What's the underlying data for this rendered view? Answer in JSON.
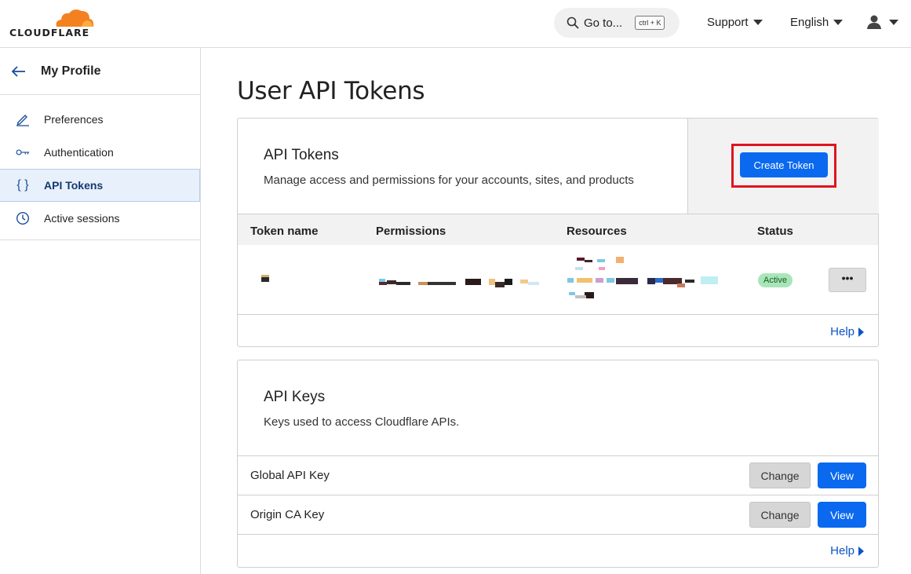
{
  "brand": {
    "logo_text": "CLOUDFLARE"
  },
  "header": {
    "goto_label": "Go to...",
    "goto_shortcut": "ctrl + K",
    "support_label": "Support",
    "language_label": "English"
  },
  "sidebar": {
    "title": "My Profile",
    "items": [
      {
        "label": "Preferences",
        "icon": "pencil-icon"
      },
      {
        "label": "Authentication",
        "icon": "key-icon"
      },
      {
        "label": "API Tokens",
        "icon": "braces-icon",
        "active": true
      },
      {
        "label": "Active sessions",
        "icon": "clock-icon"
      }
    ]
  },
  "page": {
    "title": "User API Tokens"
  },
  "api_tokens": {
    "title": "API Tokens",
    "description": "Manage access and permissions for your accounts, sites, and products",
    "create_button": "Create Token",
    "columns": [
      "Token name",
      "Permissions",
      "Resources",
      "Status"
    ],
    "rows": [
      {
        "status": "Active",
        "more": "•••"
      }
    ],
    "help_label": "Help"
  },
  "api_keys": {
    "title": "API Keys",
    "description": "Keys used to access Cloudflare APIs.",
    "keys": [
      {
        "name": "Global API Key",
        "change": "Change",
        "view": "View"
      },
      {
        "name": "Origin CA Key",
        "change": "Change",
        "view": "View"
      }
    ],
    "help_label": "Help"
  },
  "colors": {
    "accent": "#0a69ef",
    "highlight": "#e0141e",
    "brand_orange": "#f48120"
  }
}
